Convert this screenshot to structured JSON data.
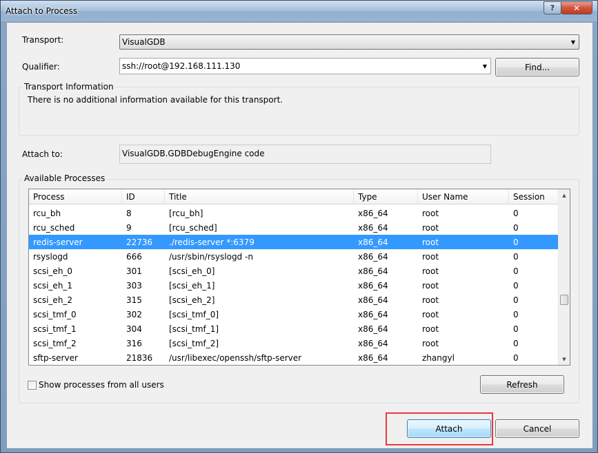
{
  "window": {
    "title": "Attach to Process"
  },
  "titlebar_buttons": {
    "help": "?",
    "close": "✕"
  },
  "transport": {
    "label": "Transport:",
    "value": "VisualGDB"
  },
  "qualifier": {
    "label": "Qualifier:",
    "value": "ssh://root@192.168.111.130",
    "find_button": "Find..."
  },
  "transport_info": {
    "title": "Transport Information",
    "text": "There is no additional information available for this transport."
  },
  "attach_to": {
    "label": "Attach to:",
    "value": "VisualGDB.GDBDebugEngine code"
  },
  "processes": {
    "title": "Available Processes",
    "columns": [
      "Process",
      "ID",
      "Title",
      "Type",
      "User Name",
      "Session"
    ],
    "rows": [
      [
        "rcu_bh",
        "8",
        "[rcu_bh]",
        "x86_64",
        "root",
        "0"
      ],
      [
        "rcu_sched",
        "9",
        "[rcu_sched]",
        "x86_64",
        "root",
        "0"
      ],
      [
        "redis-server",
        "22736",
        "./redis-server *:6379",
        "x86_64",
        "root",
        "0"
      ],
      [
        "rsyslogd",
        "666",
        "/usr/sbin/rsyslogd -n",
        "x86_64",
        "root",
        "0"
      ],
      [
        "scsi_eh_0",
        "301",
        "[scsi_eh_0]",
        "x86_64",
        "root",
        "0"
      ],
      [
        "scsi_eh_1",
        "303",
        "[scsi_eh_1]",
        "x86_64",
        "root",
        "0"
      ],
      [
        "scsi_eh_2",
        "315",
        "[scsi_eh_2]",
        "x86_64",
        "root",
        "0"
      ],
      [
        "scsi_tmf_0",
        "302",
        "[scsi_tmf_0]",
        "x86_64",
        "root",
        "0"
      ],
      [
        "scsi_tmf_1",
        "304",
        "[scsi_tmf_1]",
        "x86_64",
        "root",
        "0"
      ],
      [
        "scsi_tmf_2",
        "316",
        "[scsi_tmf_2]",
        "x86_64",
        "root",
        "0"
      ],
      [
        "sftp-server",
        "21836",
        "/usr/libexec/openssh/sftp-server",
        "x86_64",
        "zhangyl",
        "0"
      ]
    ],
    "selected_process": "redis-server",
    "show_all_label": "Show processes from all users",
    "show_all_checked": false,
    "refresh_button": "Refresh"
  },
  "footer": {
    "attach_button": "Attach",
    "cancel_button": "Cancel"
  },
  "colors": {
    "selection": "#3399ff",
    "highlight": "#e8383d"
  }
}
